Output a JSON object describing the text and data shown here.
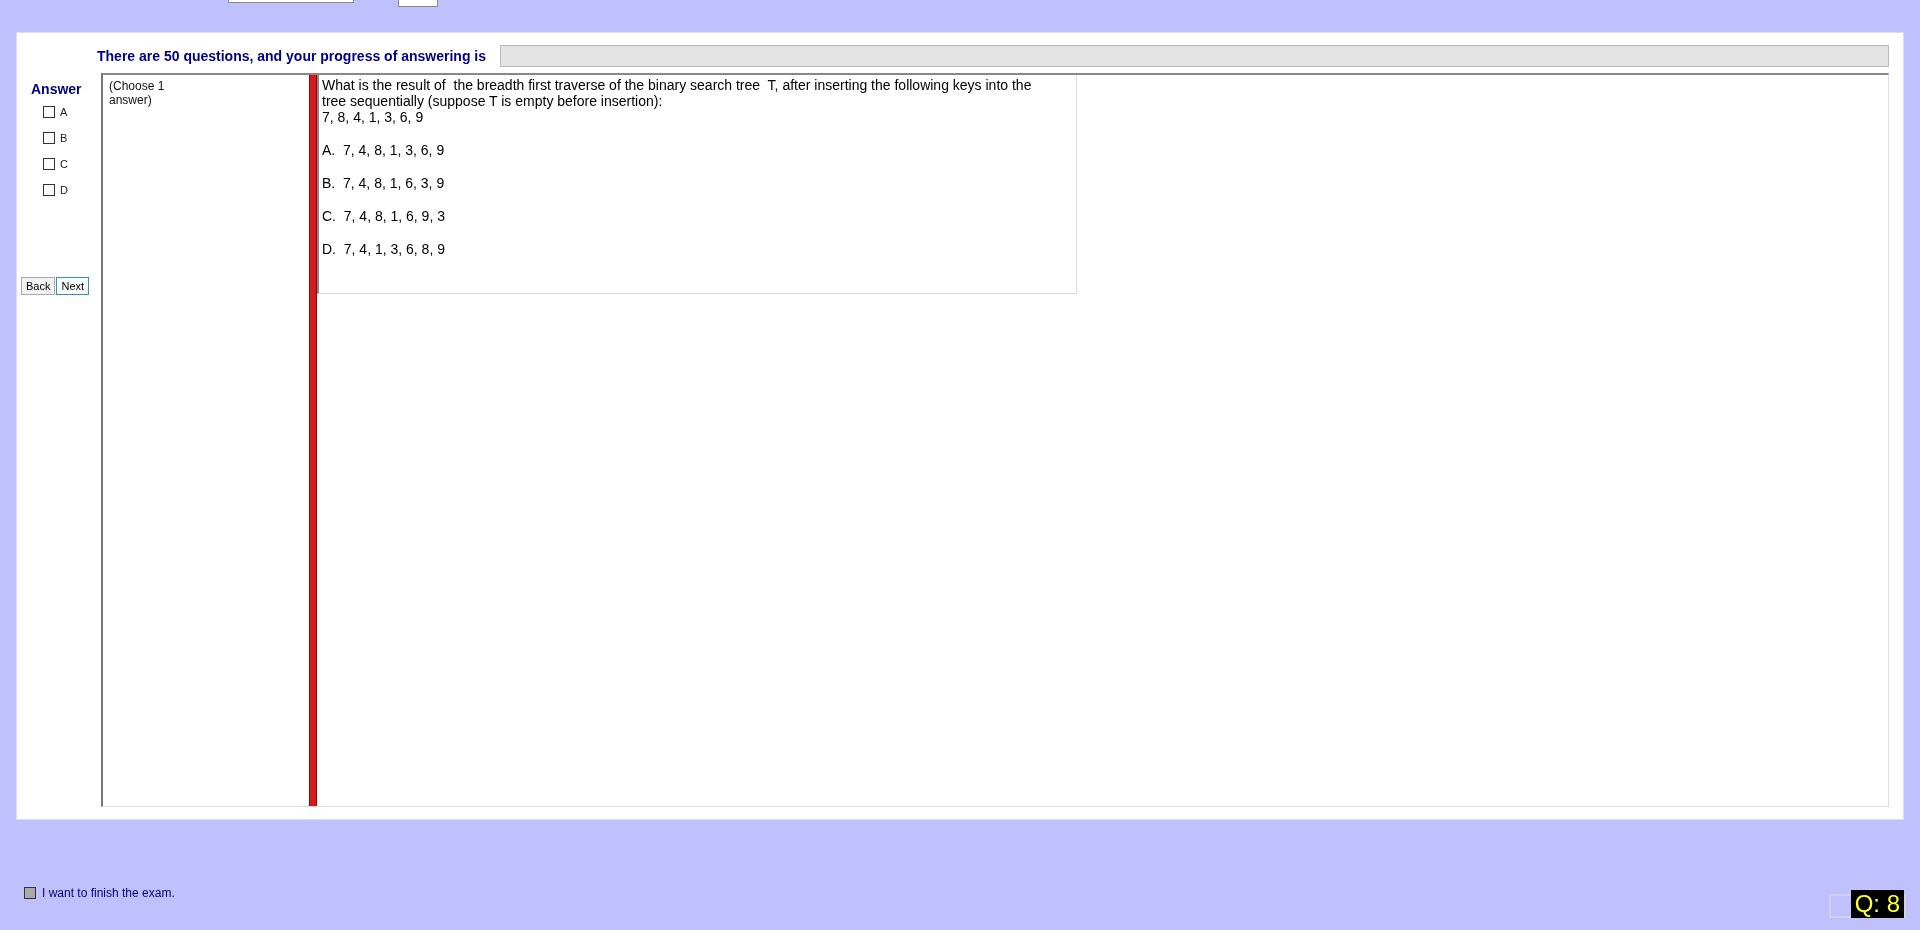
{
  "progress": {
    "label": "There are 50 questions, and your progress of answering is",
    "level": 0
  },
  "answer": {
    "title": "Answer",
    "options": [
      {
        "label": "A",
        "checked": false
      },
      {
        "label": "B",
        "checked": false
      },
      {
        "label": "C",
        "checked": false
      },
      {
        "label": "D",
        "checked": false
      }
    ]
  },
  "nav_buttons": [
    "Back",
    "Next"
  ],
  "instruction": "(Choose 1 answer)",
  "question": {
    "lines": [
      "What is the result of  the breadth first traverse of the binary search tree  T, after inserting the following keys into the tree sequentially (suppose T is empty before insertion):",
      "7, 8, 4, 1, 3, 6, 9"
    ],
    "choices": [
      "A.  7, 4, 8, 1, 3, 6, 9",
      "B.  7, 4, 8, 1, 6, 3, 9",
      "C.  7, 4, 8, 1, 6, 9, 3",
      "D.  7, 4, 1, 3, 6, 8, 9"
    ]
  },
  "finish": {
    "label": "I want to finish the exam.",
    "checked": false
  },
  "question_number": "Q: 8"
}
